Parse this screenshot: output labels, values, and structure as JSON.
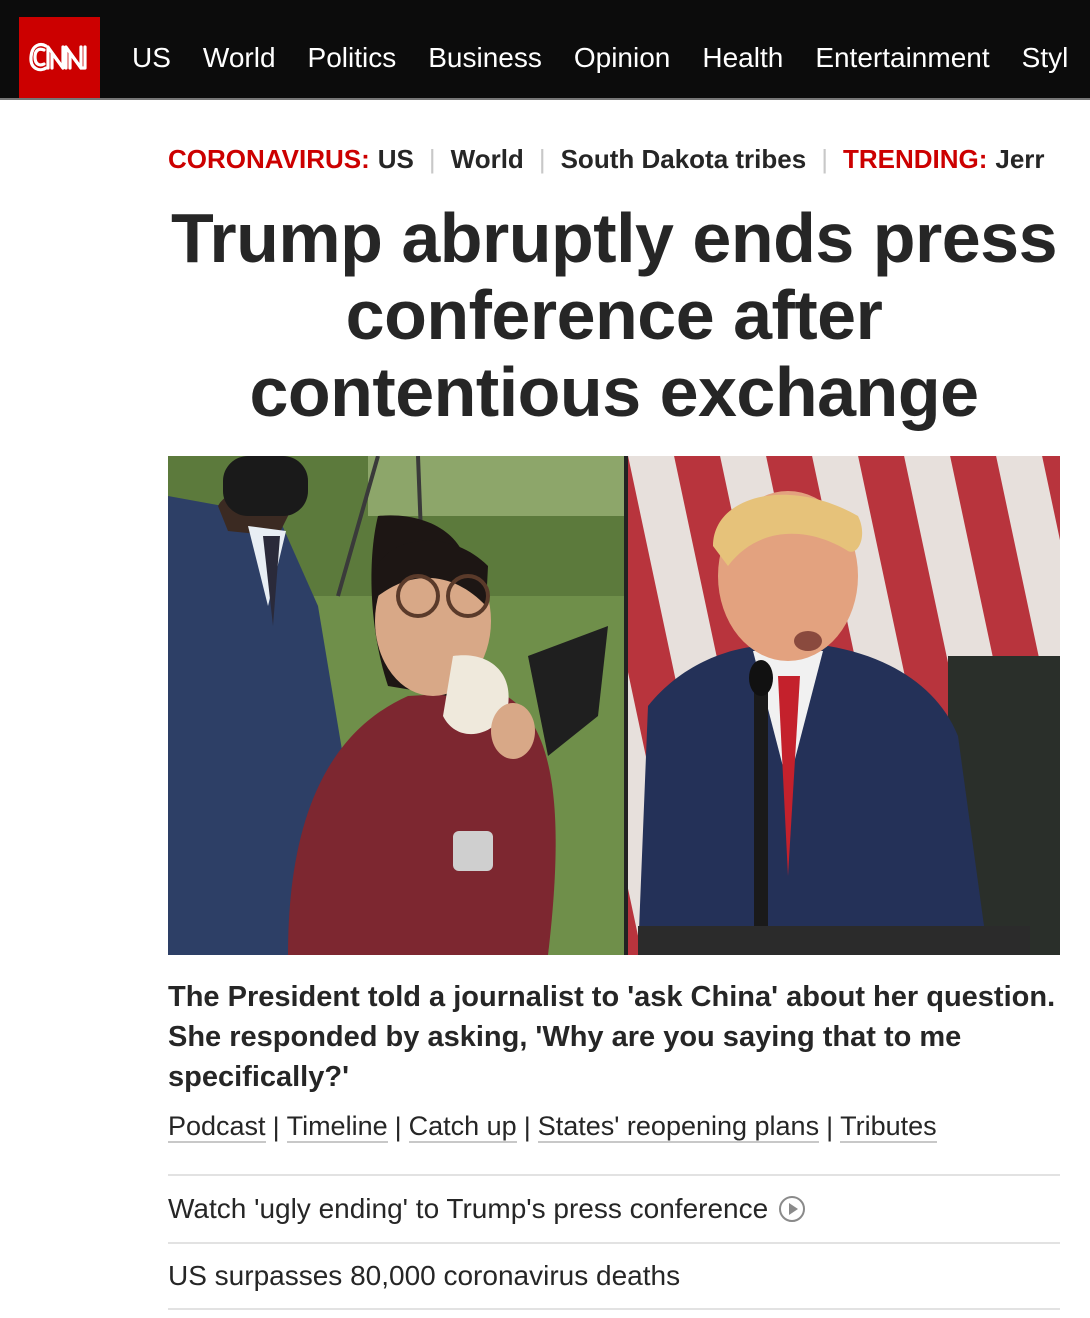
{
  "brand": {
    "logo_text": "CNN",
    "brand_color": "#cc0000"
  },
  "nav": {
    "items": [
      "US",
      "World",
      "Politics",
      "Business",
      "Opinion",
      "Health",
      "Entertainment",
      "Styl"
    ]
  },
  "breadcrumbs": {
    "section_label": "CORONAVIRUS:",
    "section_links": [
      "US",
      "World",
      "South Dakota tribes"
    ],
    "trending_label": "TRENDING:",
    "trending_link": "Jerr"
  },
  "article": {
    "headline": "Trump abruptly ends press conference after contentious exchange",
    "image_alt": "journalist-and-president-split-photo",
    "summary": "The President told a journalist to 'ask China' about her question. She responded by asking, 'Why are you saying that to me specifically?'",
    "related_links": [
      "Podcast",
      "Timeline",
      "Catch up",
      "States' reopening plans",
      "Tributes"
    ]
  },
  "stories": [
    {
      "title": "Watch 'ugly ending' to Trump's press conference",
      "icon": "play-icon"
    },
    {
      "title": "US surpasses 80,000 coronavirus deaths",
      "icon": ""
    }
  ]
}
